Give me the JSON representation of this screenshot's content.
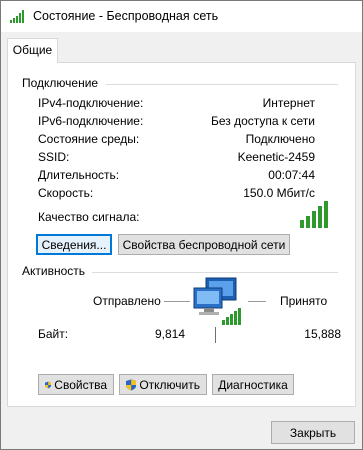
{
  "window": {
    "title": "Состояние - Беспроводная сеть",
    "icon": "wifi-signal-icon"
  },
  "tabs": [
    {
      "label": "Общие"
    }
  ],
  "connection": {
    "heading": "Подключение",
    "rows": [
      {
        "label": "IPv4-подключение:",
        "value": "Интернет"
      },
      {
        "label": "IPv6-подключение:",
        "value": "Без доступа к сети"
      },
      {
        "label": "Состояние среды:",
        "value": "Подключено"
      },
      {
        "label": "SSID:",
        "value": "Keenetic-2459"
      },
      {
        "label": "Длительность:",
        "value": "00:07:44"
      },
      {
        "label": "Скорость:",
        "value": "150.0 Мбит/с"
      }
    ],
    "signal_label": "Качество сигнала:",
    "signal_bars": 5,
    "details_button": "Сведения...",
    "wireless_props_button": "Свойства беспроводной сети"
  },
  "activity": {
    "heading": "Активность",
    "sent_label": "Отправлено",
    "received_label": "Принято",
    "bytes_label": "Байт:",
    "bytes_sent": "9,814",
    "bytes_received": "15,888"
  },
  "actions": {
    "properties": "Свойства",
    "disable": "Отключить",
    "diagnose": "Диагностика"
  },
  "footer": {
    "close": "Закрыть"
  },
  "colors": {
    "signal": "#2e9a2e",
    "focus": "#0078d7",
    "shield_blue": "#2b63c6",
    "shield_yellow": "#f2c31c"
  }
}
